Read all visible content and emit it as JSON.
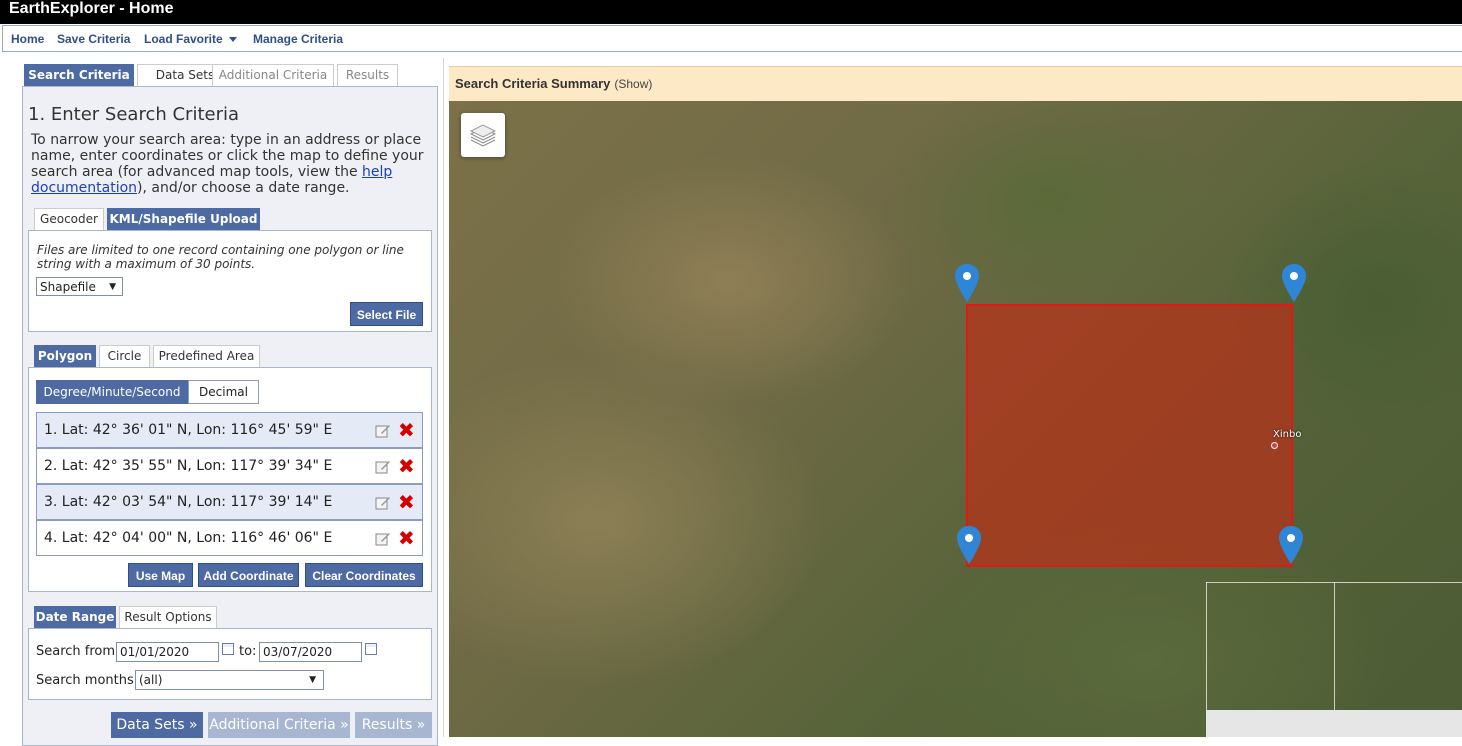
{
  "window": {
    "title": "EarthExplorer - Home"
  },
  "menu": {
    "home": "Home",
    "save_criteria": "Save Criteria",
    "load_favorite": "Load Favorite",
    "manage_criteria": "Manage Criteria"
  },
  "main_tabs": {
    "search_criteria": "Search Criteria",
    "data_sets": "Data Sets",
    "additional_criteria": "Additional Criteria",
    "results": "Results"
  },
  "section": {
    "heading": "1. Enter Search Criteria",
    "intro_pre": "To narrow your search area: type in an address or place name, enter coordinates or click the map to define your search area (for advanced map tools, view the ",
    "intro_link": "help documentation",
    "intro_post": "), and/or choose a date range."
  },
  "upload_tabs": {
    "geocoder": "Geocoder",
    "kml": "KML/Shapefile Upload"
  },
  "upload": {
    "note": "Files are limited to one record containing one polygon or line string with a maximum of 30 points.",
    "file_type": "Shapefile",
    "select_file": "Select File"
  },
  "shape_tabs": {
    "polygon": "Polygon",
    "circle": "Circle",
    "predefined": "Predefined Area"
  },
  "coord_format": {
    "dms": "Degree/Minute/Second",
    "decimal": "Decimal"
  },
  "coordinates": [
    "1.  Lat: 42° 36' 01\" N, Lon: 116° 45' 59\" E",
    "2.  Lat: 42° 35' 55\" N, Lon: 117° 39' 34\" E",
    "3.  Lat: 42° 03' 54\" N, Lon: 117° 39' 14\" E",
    "4.  Lat: 42° 04' 00\" N, Lon: 116° 46' 06\" E"
  ],
  "coord_buttons": {
    "use_map": "Use Map",
    "add": "Add Coordinate",
    "clear": "Clear Coordinates"
  },
  "date_tabs": {
    "date_range": "Date Range",
    "result_options": "Result Options"
  },
  "date": {
    "from_label": "Search from:",
    "from": "01/01/2020",
    "to_label": "to:",
    "to": "03/07/2020",
    "months_label": "Search months:",
    "months": "(all)"
  },
  "bottom_nav": {
    "data_sets": "Data Sets »",
    "additional": "Additional Criteria »",
    "results": "Results »"
  },
  "summary": {
    "title": "Search Criteria Summary",
    "toggle": "(Show)"
  },
  "map": {
    "place_label": "Xinbo",
    "polygon_color": "#e01818",
    "pin_color": "#2f86d6"
  },
  "colors": {
    "accent": "#4d6aa3",
    "title_bar": "#000000",
    "summary_bg": "#fde9c6"
  }
}
